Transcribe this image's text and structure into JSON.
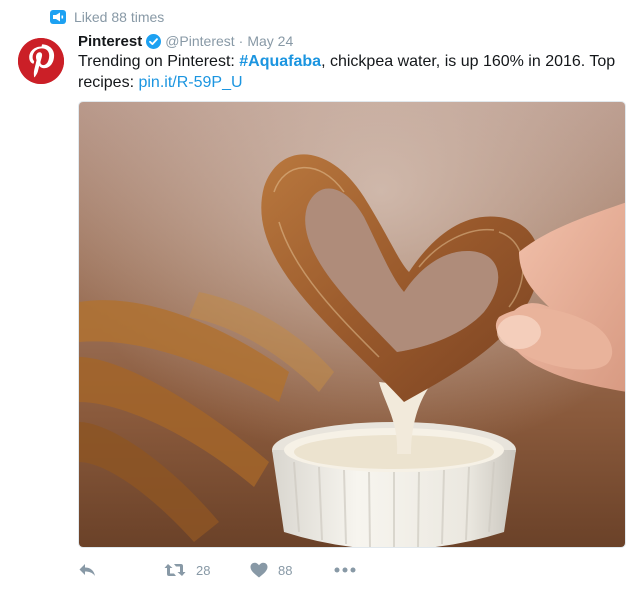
{
  "social_context": {
    "text": "Liked 88 times",
    "icon": "megaphone-icon"
  },
  "tweet": {
    "author_name": "Pinterest",
    "handle": "@Pinterest",
    "separator": "·",
    "date": "May 24",
    "text_before": "Trending on Pinterest: ",
    "hashtag": "#Aquafaba",
    "text_after": ", chickpea water, is up 160% in 2016. Top recipes: ",
    "link": "pin.it/R-59P_U",
    "media_alt": "Heart-shaped churro dipped in white cream sauce",
    "brand_color": "#cb1f27",
    "link_color": "#1b95e0"
  },
  "actions": {
    "reply_icon": "reply-icon",
    "retweet_icon": "retweet-icon",
    "retweet_count": "28",
    "like_icon": "heart-icon",
    "like_count": "88",
    "more_icon": "more-icon"
  }
}
